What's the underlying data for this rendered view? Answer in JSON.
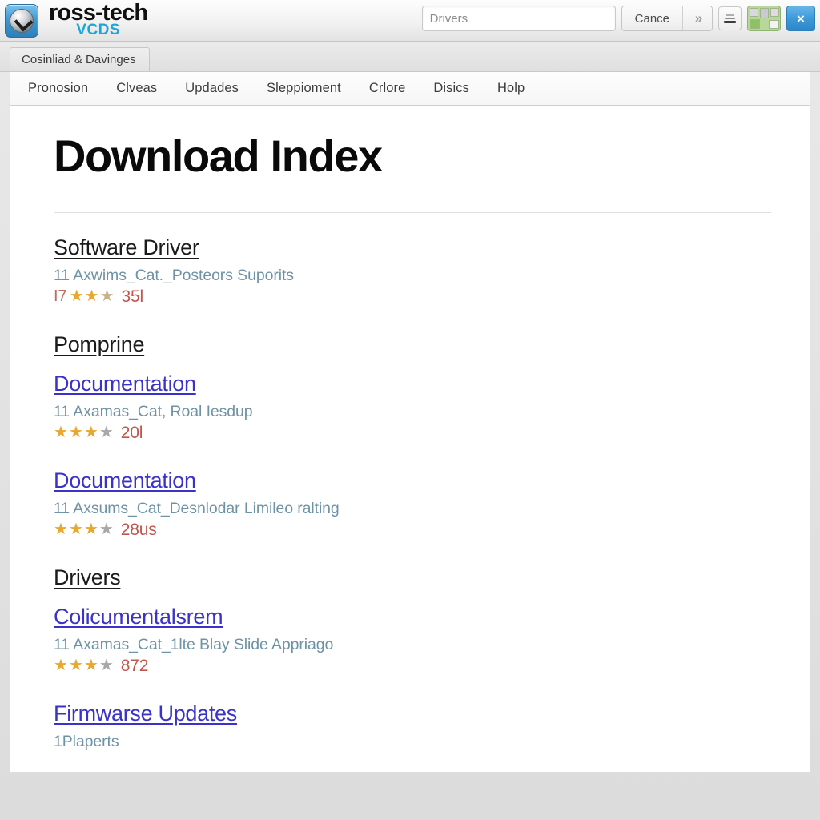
{
  "app": {
    "brand_name": "ross-tech",
    "brand_sub": "VCDS",
    "logo_icon": "disc-arrow-icon",
    "accent_blue": "#1ba6d6",
    "link_color": "#3b32c8",
    "star_color": "#e8a82e",
    "count_color": "#c0564e"
  },
  "titlebar": {
    "search_value": "Drivers",
    "search_placeholder": "Drivers",
    "cancel_label": "Cance",
    "forward_icon": "double-chevron-right-icon",
    "list_icon": "list-view-icon",
    "apps_icon": "apps-grid-icon",
    "close_label": "×"
  },
  "tabs": {
    "active_label": "Cosinliad & Davinges"
  },
  "menubar": {
    "items": [
      {
        "label": "Pronosion"
      },
      {
        "label": "Clveas"
      },
      {
        "label": "Updades"
      },
      {
        "label": "Sleppioment"
      },
      {
        "label": "Crlore"
      },
      {
        "label": "Disics"
      },
      {
        "label": "Holp"
      }
    ]
  },
  "page": {
    "title": "Download Index",
    "results": [
      {
        "heading": "Software Driver",
        "is_link": false,
        "subtitle": "11 Axwims_Cat._Posteors Suporits",
        "rating_prefix": "I7",
        "stars_on": 2,
        "stars_faint": 1,
        "stars_off": 0,
        "count": "35l"
      },
      {
        "heading": "Pomprine",
        "is_link": false,
        "subtitle": "",
        "rating_prefix": "",
        "stars_on": 0,
        "stars_faint": 0,
        "stars_off": 0,
        "count": ""
      },
      {
        "heading": "Documentation",
        "is_link": true,
        "subtitle": "11 Axamas_Cat, Roal Iesdup",
        "rating_prefix": "",
        "stars_on": 3,
        "stars_faint": 0,
        "stars_off": 1,
        "count": "20l"
      },
      {
        "heading": "Documentation",
        "is_link": true,
        "subtitle": "11 Axsums_Cat_Desnlodar Limileo ralting",
        "rating_prefix": "",
        "stars_on": 3,
        "stars_faint": 0,
        "stars_off": 1,
        "count": "28us"
      },
      {
        "heading": "Drivers",
        "is_link": false,
        "subtitle": "",
        "rating_prefix": "",
        "stars_on": 0,
        "stars_faint": 0,
        "stars_off": 0,
        "count": ""
      },
      {
        "heading": "Colicumentalsrem",
        "is_link": true,
        "subtitle": "11 Axamas_Cat_1lte Blay Slide Appriago",
        "rating_prefix": "",
        "stars_on": 3,
        "stars_faint": 0,
        "stars_off": 1,
        "count": "872"
      },
      {
        "heading": "Firmwarse Updates",
        "is_link": true,
        "subtitle": "1Plaperts",
        "rating_prefix": "",
        "stars_on": 0,
        "stars_faint": 0,
        "stars_off": 0,
        "count": ""
      }
    ]
  }
}
